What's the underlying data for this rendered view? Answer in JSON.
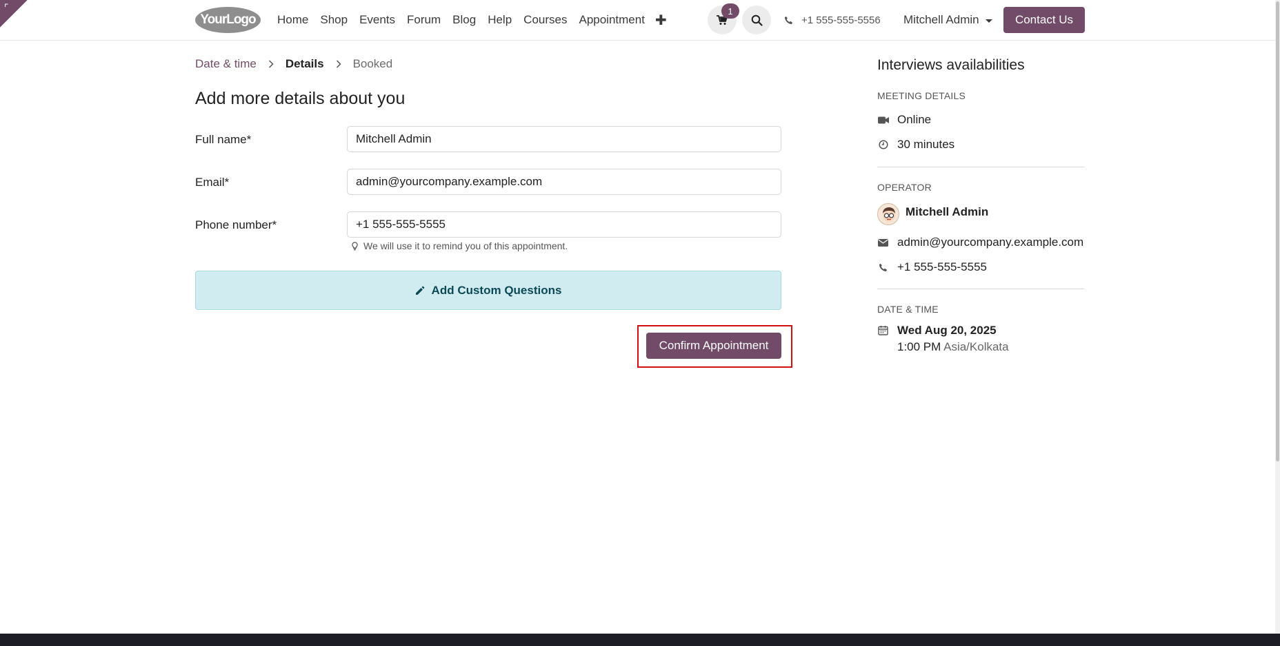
{
  "header": {
    "logo_text": "YourLogo",
    "nav": [
      "Home",
      "Shop",
      "Events",
      "Forum",
      "Blog",
      "Help",
      "Courses",
      "Appointment"
    ],
    "cart_count": "1",
    "phone": "+1 555-555-5556",
    "user": "Mitchell Admin",
    "contact_label": "Contact Us"
  },
  "breadcrumb": {
    "step1": "Date & time",
    "step2": "Details",
    "step3": "Booked"
  },
  "form": {
    "title": "Add more details about you",
    "fullname_label": "Full name*",
    "fullname_value": "Mitchell Admin",
    "email_label": "Email*",
    "email_value": "admin@yourcompany.example.com",
    "phone_label": "Phone number*",
    "phone_value": "+1 555-555-5555",
    "phone_hint": "We will use it to remind you of this appointment.",
    "add_questions_label": "Add Custom Questions",
    "confirm_label": "Confirm Appointment"
  },
  "sidebar": {
    "title": "Interviews availabilities",
    "meeting_details_heading": "MEETING DETAILS",
    "location": "Online",
    "duration": "30 minutes",
    "operator_heading": "OPERATOR",
    "operator_name": "Mitchell Admin",
    "operator_email": "admin@yourcompany.example.com",
    "operator_phone": "+1 555-555-5555",
    "datetime_heading": "DATE & TIME",
    "date": "Wed Aug 20, 2025",
    "time": "1:00 PM",
    "timezone": "Asia/Kolkata"
  },
  "colors": {
    "brand": "#714b67",
    "highlight": "#d20f0f",
    "info_bg": "#d1ecf1"
  }
}
